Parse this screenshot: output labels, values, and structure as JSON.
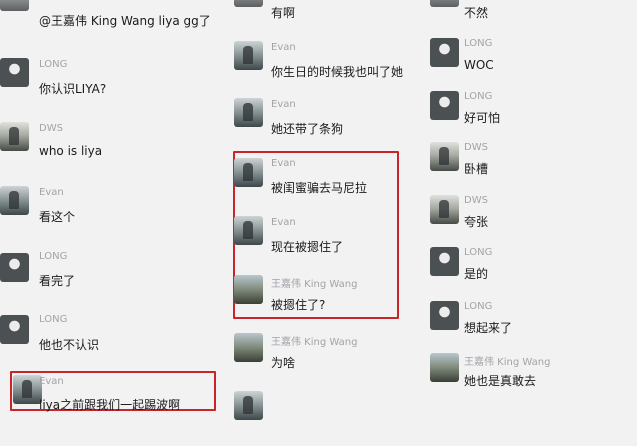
{
  "columns": [
    {
      "messages": [
        {
          "sender": "",
          "text": "@王嘉伟 King Wang liya gg了",
          "avatar": "hidden-avatar"
        },
        {
          "sender": "LONG",
          "text": "你认识LIYA?",
          "avatar": "long-avatar"
        },
        {
          "sender": "DWS",
          "text": "who is liya",
          "avatar": "dws-avatar"
        },
        {
          "sender": "Evan",
          "text": "看这个",
          "avatar": "evan-avatar"
        },
        {
          "sender": "LONG",
          "text": "看完了",
          "avatar": "long-avatar"
        },
        {
          "sender": "LONG",
          "text": "他也不认识",
          "avatar": "long-avatar"
        },
        {
          "sender": "Evan",
          "text": "liya之前跟我们一起踢波啊",
          "avatar": "evan-avatar"
        }
      ]
    },
    {
      "messages": [
        {
          "sender": "",
          "text": "有啊",
          "avatar": "hidden-avatar"
        },
        {
          "sender": "Evan",
          "text": "你生日的时候我也叫了她",
          "avatar": "evan-avatar"
        },
        {
          "sender": "Evan",
          "text": "她还带了条狗",
          "avatar": "evan-avatar"
        },
        {
          "sender": "Evan",
          "text": "被闺蜜骗去马尼拉",
          "avatar": "evan-avatar"
        },
        {
          "sender": "Evan",
          "text": "现在被摁住了",
          "avatar": "evan-avatar"
        },
        {
          "sender": "王嘉伟 King Wang",
          "text": "被摁住了?",
          "avatar": "wang-avatar"
        },
        {
          "sender": "王嘉伟 King Wang",
          "text": "为啥",
          "avatar": "wang-avatar"
        },
        {
          "sender": "",
          "text": "",
          "avatar": "hidden-avatar"
        }
      ]
    },
    {
      "messages": [
        {
          "sender": "",
          "text": "不然",
          "avatar": "hidden-avatar"
        },
        {
          "sender": "LONG",
          "text": "WOC",
          "avatar": "long-avatar"
        },
        {
          "sender": "LONG",
          "text": "好可怕",
          "avatar": "long-avatar"
        },
        {
          "sender": "DWS",
          "text": "卧槽",
          "avatar": "dws-avatar"
        },
        {
          "sender": "DWS",
          "text": "夸张",
          "avatar": "dws-avatar"
        },
        {
          "sender": "LONG",
          "text": "是的",
          "avatar": "long-avatar"
        },
        {
          "sender": "LONG",
          "text": "想起来了",
          "avatar": "long-avatar"
        },
        {
          "sender": "王嘉伟 King Wang",
          "text": "她也是真敢去",
          "avatar": "wang-avatar"
        }
      ]
    }
  ],
  "colors": {
    "highlight": "#c9242a",
    "background": "#f2f2f3",
    "name": "#a3a3a8",
    "text": "#1b1b1d"
  }
}
